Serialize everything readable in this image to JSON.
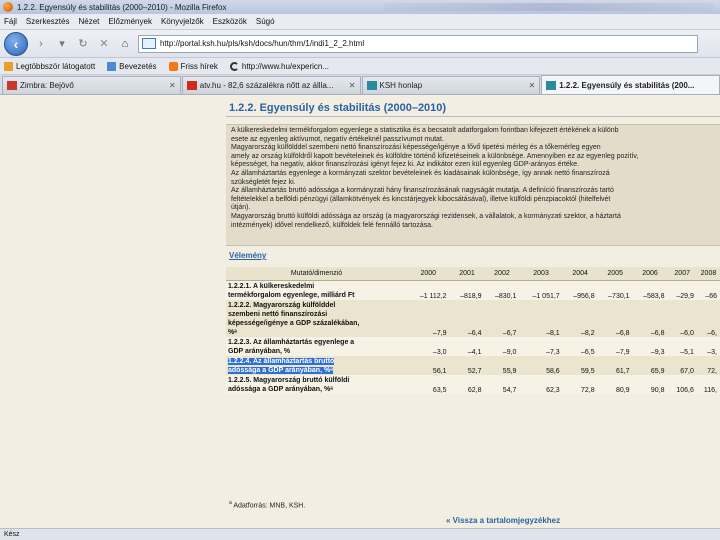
{
  "window": {
    "title": "1.2.2. Egyensúly és stabilitás (2000–2010) - Mozilla Firefox"
  },
  "menu": [
    "Fájl",
    "Szerkesztés",
    "Nézet",
    "Előzmények",
    "Könyvjelzők",
    "Eszközök",
    "Súgó"
  ],
  "nav": {
    "url": "http://portal.ksh.hu/pls/ksh/docs/hun/thm/1/indi1_2_2.html"
  },
  "bookmarks": [
    {
      "label": "Legtöbbször látogatott",
      "icon": "page-icon",
      "color": "#e8a02a"
    },
    {
      "label": "Bevezetés",
      "icon": "page-icon",
      "color": "#4b8ad6"
    },
    {
      "label": "Friss hírek",
      "icon": "rss-icon",
      "color": "#f07a18"
    },
    {
      "label": "http://www.hu/expericn...",
      "icon": "c-icon",
      "color": "#333333"
    }
  ],
  "tabs": [
    {
      "title": "Zimbra: Bejövő",
      "icon": "zimbra-icon",
      "color": "#c8362c",
      "active": false
    },
    {
      "title": "atv.hu - 82,6 százalékra nőtt az állla...",
      "icon": "atv-icon",
      "color": "#d22a1c",
      "active": false
    },
    {
      "title": "KSH honlap",
      "icon": "ksh-icon",
      "color": "#2b8a9d",
      "active": false
    },
    {
      "title": "1.2.2. Egyensúly és stabilitás (200...",
      "icon": "ksh-icon",
      "color": "#2b8a9d",
      "active": true
    }
  ],
  "page": {
    "title": "1.2.2. Egyensúly és stabilitás (2000–2010)",
    "summary": [
      "A külkereskedelmi termékforgalom egyenlege a statisztika és a becsatolt adatforgalom forintban kifejezett értékének a különb",
      "esete az egyenleg aktívumot, negatív értékeknél passzívumot mutat.",
      "Magyarország külfölddel szembeni nettó finanszírozási képessége/igénye a fővő tipetési mérleg és a tőkemérleg egyen",
      "amely az ország külföldről kapott bevételeinek és külföldre történő kifizetéseinek a különbsége. Amennyiben ez az egyenleg pozitív,",
      "képességet, ha negatív, akkor finanszírozási igényt fejez ki. Az indikátor ezen kül egyenleg GDP-arányos értéke.",
      "Az államháztartás egyenlege a kormányzati szektor bevételeinek és kiadásainak különbsége, így annak nettó finanszírozá",
      "szükségletét fejez ki.",
      "Az államháztartás bruttó adóssága a kormányzati hány finanszírozásának nagyságát mutatja. A definíció finanszírozás tartó",
      "feltételekkel a belföldi pénzügyi (államkötvények és kincstárjegyek kibocsátásával), illetve külföldi pénzpiacoktól (hitelfelvét",
      "útján).",
      "Magyarország bruttó külföldi adóssága az ország (a magyarországi rezidensek, a vállalatok, a kormányzati szektor, a háztartá",
      "intézmények) idővel rendelkező, külföldek felé fennálló tartozása."
    ],
    "velemeny": "Vélemény",
    "table": {
      "header_dim": "Mutató/dimenzió",
      "years": [
        "2000",
        "2001",
        "2002",
        "2003",
        "2004",
        "2005",
        "2006",
        "2007",
        "2008"
      ],
      "rows": [
        {
          "label": "1.2.2.1. A külkereskedelmi\ntermékforgalom egyenlege, milliárd Ft",
          "values": [
            "–1 112,2",
            "–818,9",
            "–830,1",
            "–1 051,7",
            "–956,8",
            "–730,1",
            "–583,8",
            "–29,9",
            "–66"
          ]
        },
        {
          "label": "1.2.2.2. Magyarország külfölddel\nszembeni nettó finanszírozási\nképessége/igénye a GDP százalékában,\n%ᵃ",
          "values": [
            "–7,9",
            "–6,4",
            "–6,7",
            "–8,1",
            "–8,2",
            "–6,8",
            "–6,8",
            "–6,0",
            "–6,"
          ]
        },
        {
          "label": "1.2.2.3. Az államháztartás egyenlege a\nGDP arányában, %",
          "values": [
            "–3,0",
            "–4,1",
            "–9,0",
            "–7,3",
            "–6,5",
            "–7,9",
            "–9,3",
            "–5,1",
            "–3,"
          ]
        },
        {
          "label": "1.2.2.4. Az államháztartás bruttó\nadóssága a GDP arányában, %ᵃ",
          "values": [
            "56,1",
            "52,7",
            "55,9",
            "58,6",
            "59,5",
            "61,7",
            "65,9",
            "67,0",
            "72,"
          ]
        },
        {
          "label": "1.2.2.5. Magyarország bruttó külföldi\nadóssága a GDP arányában, %ᵃ",
          "values": [
            "63,5",
            "62,8",
            "54,7",
            "62,3",
            "72,8",
            "80,9",
            "90,8",
            "106,6",
            "116,"
          ]
        }
      ]
    },
    "footnote_mark": "a",
    "footnote": "Adatforrás: MNB, KSH.",
    "back_link": "« Vissza a tartalomjegyzékhez"
  },
  "status": "Kész"
}
